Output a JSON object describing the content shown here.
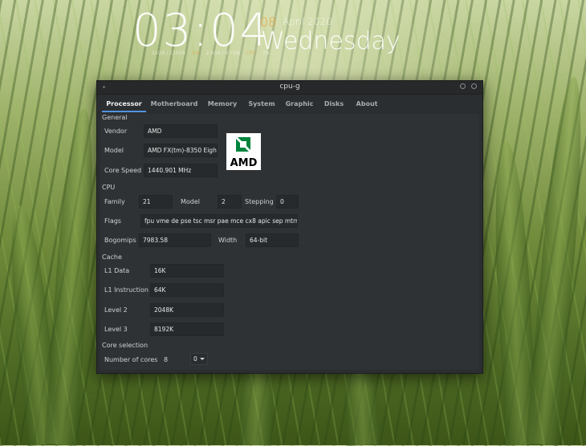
{
  "clock": {
    "time": "03:04",
    "day": "08",
    "month_year": "April 2020",
    "weekday": "Wednesday",
    "stats": [
      "24GB / 226GB",
      "5%",
      "2.6GB / 8.7GB",
      "CPU",
      "3%"
    ]
  },
  "window": {
    "title": "cpu-g"
  },
  "tabs": [
    {
      "label": "Processor",
      "active": true
    },
    {
      "label": "Motherboard",
      "active": false
    },
    {
      "label": "Memory",
      "active": false
    },
    {
      "label": "System",
      "active": false
    },
    {
      "label": "Graphic",
      "active": false
    },
    {
      "label": "Disks",
      "active": false
    },
    {
      "label": "About",
      "active": false
    }
  ],
  "general": {
    "title": "General",
    "vendor_label": "Vendor",
    "vendor_value": "AMD",
    "model_label": "Model",
    "model_value": "AMD FX(tm)-8350 Eigh",
    "core_speed_label": "Core Speed",
    "core_speed_value": "1440.901 MHz",
    "logo_text": "AMD"
  },
  "cpu": {
    "title": "CPU",
    "family_label": "Family",
    "family_value": "21",
    "model_label": "Model",
    "model_value": "2",
    "stepping_label": "Stepping",
    "stepping_value": "0",
    "flags_label": "Flags",
    "flags_value": "fpu vme de pse tsc msr pae mce cx8 apic sep mtrr p",
    "bogomips_label": "Bogomips",
    "bogomips_value": "7983.58",
    "width_label": "Width",
    "width_value": "64-bit"
  },
  "cache": {
    "title": "Cache",
    "l1_data_label": "L1 Data",
    "l1_data_value": "16K",
    "l1_instruction_label": "L1 Instruction",
    "l1_instruction_value": "64K",
    "level2_label": "Level 2",
    "level2_value": "2048K",
    "level3_label": "Level 3",
    "level3_value": "8192K"
  },
  "core_selection": {
    "title": "Core selection",
    "number_of_cores_label": "Number of cores",
    "number_of_cores_value": "8",
    "selected_core": "0"
  },
  "colors": {
    "accent": "#5294e2",
    "clock_accent": "#e8a23c",
    "window_bg": "#2b2e30",
    "amd_green": "#00843d"
  }
}
